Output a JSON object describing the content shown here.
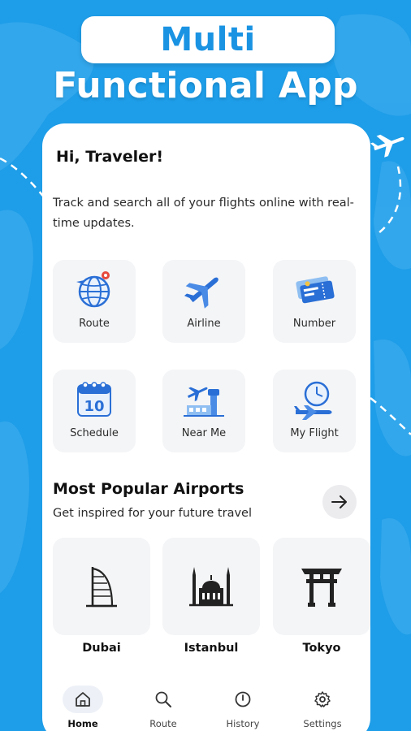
{
  "headline": {
    "line1": "Multi",
    "line2": "Functional App"
  },
  "colors": {
    "background": "#1e9de8",
    "accent": "#1a93e3",
    "icon_blue": "#2a6fd6"
  },
  "home": {
    "greeting": "Hi, Traveler!",
    "intro": "Track and search all of your flights online with real-time updates.",
    "tiles": [
      {
        "label": "Route",
        "icon": "globe-route-icon"
      },
      {
        "label": "Airline",
        "icon": "airplane-icon"
      },
      {
        "label": "Number",
        "icon": "ticket-icon"
      },
      {
        "label": "Schedule",
        "icon": "calendar-icon"
      },
      {
        "label": "Near Me",
        "icon": "airport-tower-icon"
      },
      {
        "label": "My Flight",
        "icon": "clock-plane-icon"
      }
    ],
    "calendar_day": "10",
    "popular": {
      "title": "Most Popular Airports",
      "subtitle": "Get inspired for your future travel",
      "airports": [
        {
          "name": "Dubai",
          "icon": "burj-al-arab-icon"
        },
        {
          "name": "Istanbul",
          "icon": "mosque-icon"
        },
        {
          "name": "Tokyo",
          "icon": "torii-gate-icon"
        }
      ]
    }
  },
  "nav": [
    {
      "label": "Home",
      "icon": "home-icon",
      "active": true
    },
    {
      "label": "Route",
      "icon": "search-icon",
      "active": false
    },
    {
      "label": "History",
      "icon": "history-icon",
      "active": false
    },
    {
      "label": "Settings",
      "icon": "gear-icon",
      "active": false
    }
  ]
}
